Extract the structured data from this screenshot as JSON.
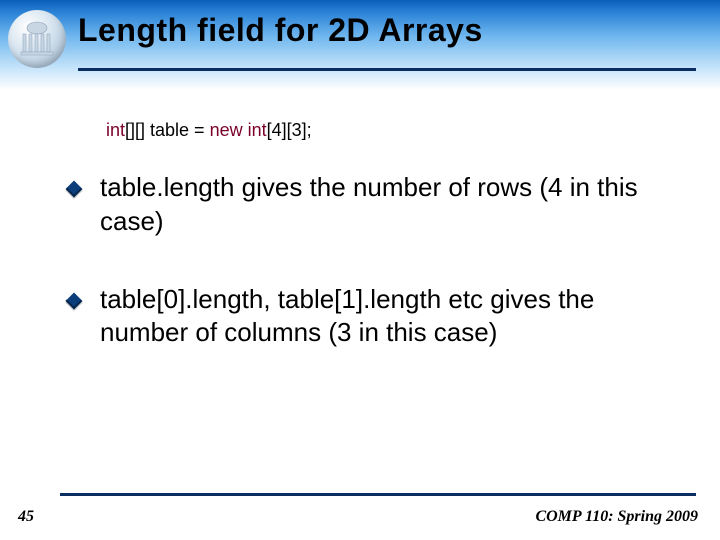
{
  "title": "Length field for 2D Arrays",
  "code": {
    "kw1": "int",
    "seg1": "[][] table = ",
    "kw2": "new",
    "seg2": " ",
    "kw3": "int",
    "seg3": "[4][3];"
  },
  "bullets": [
    "table.length gives the number of rows (4 in this case)",
    "table[0].length, table[1].length etc gives the number of columns (3 in this case)"
  ],
  "slide_number": "45",
  "footer": "COMP 110: Spring 2009"
}
